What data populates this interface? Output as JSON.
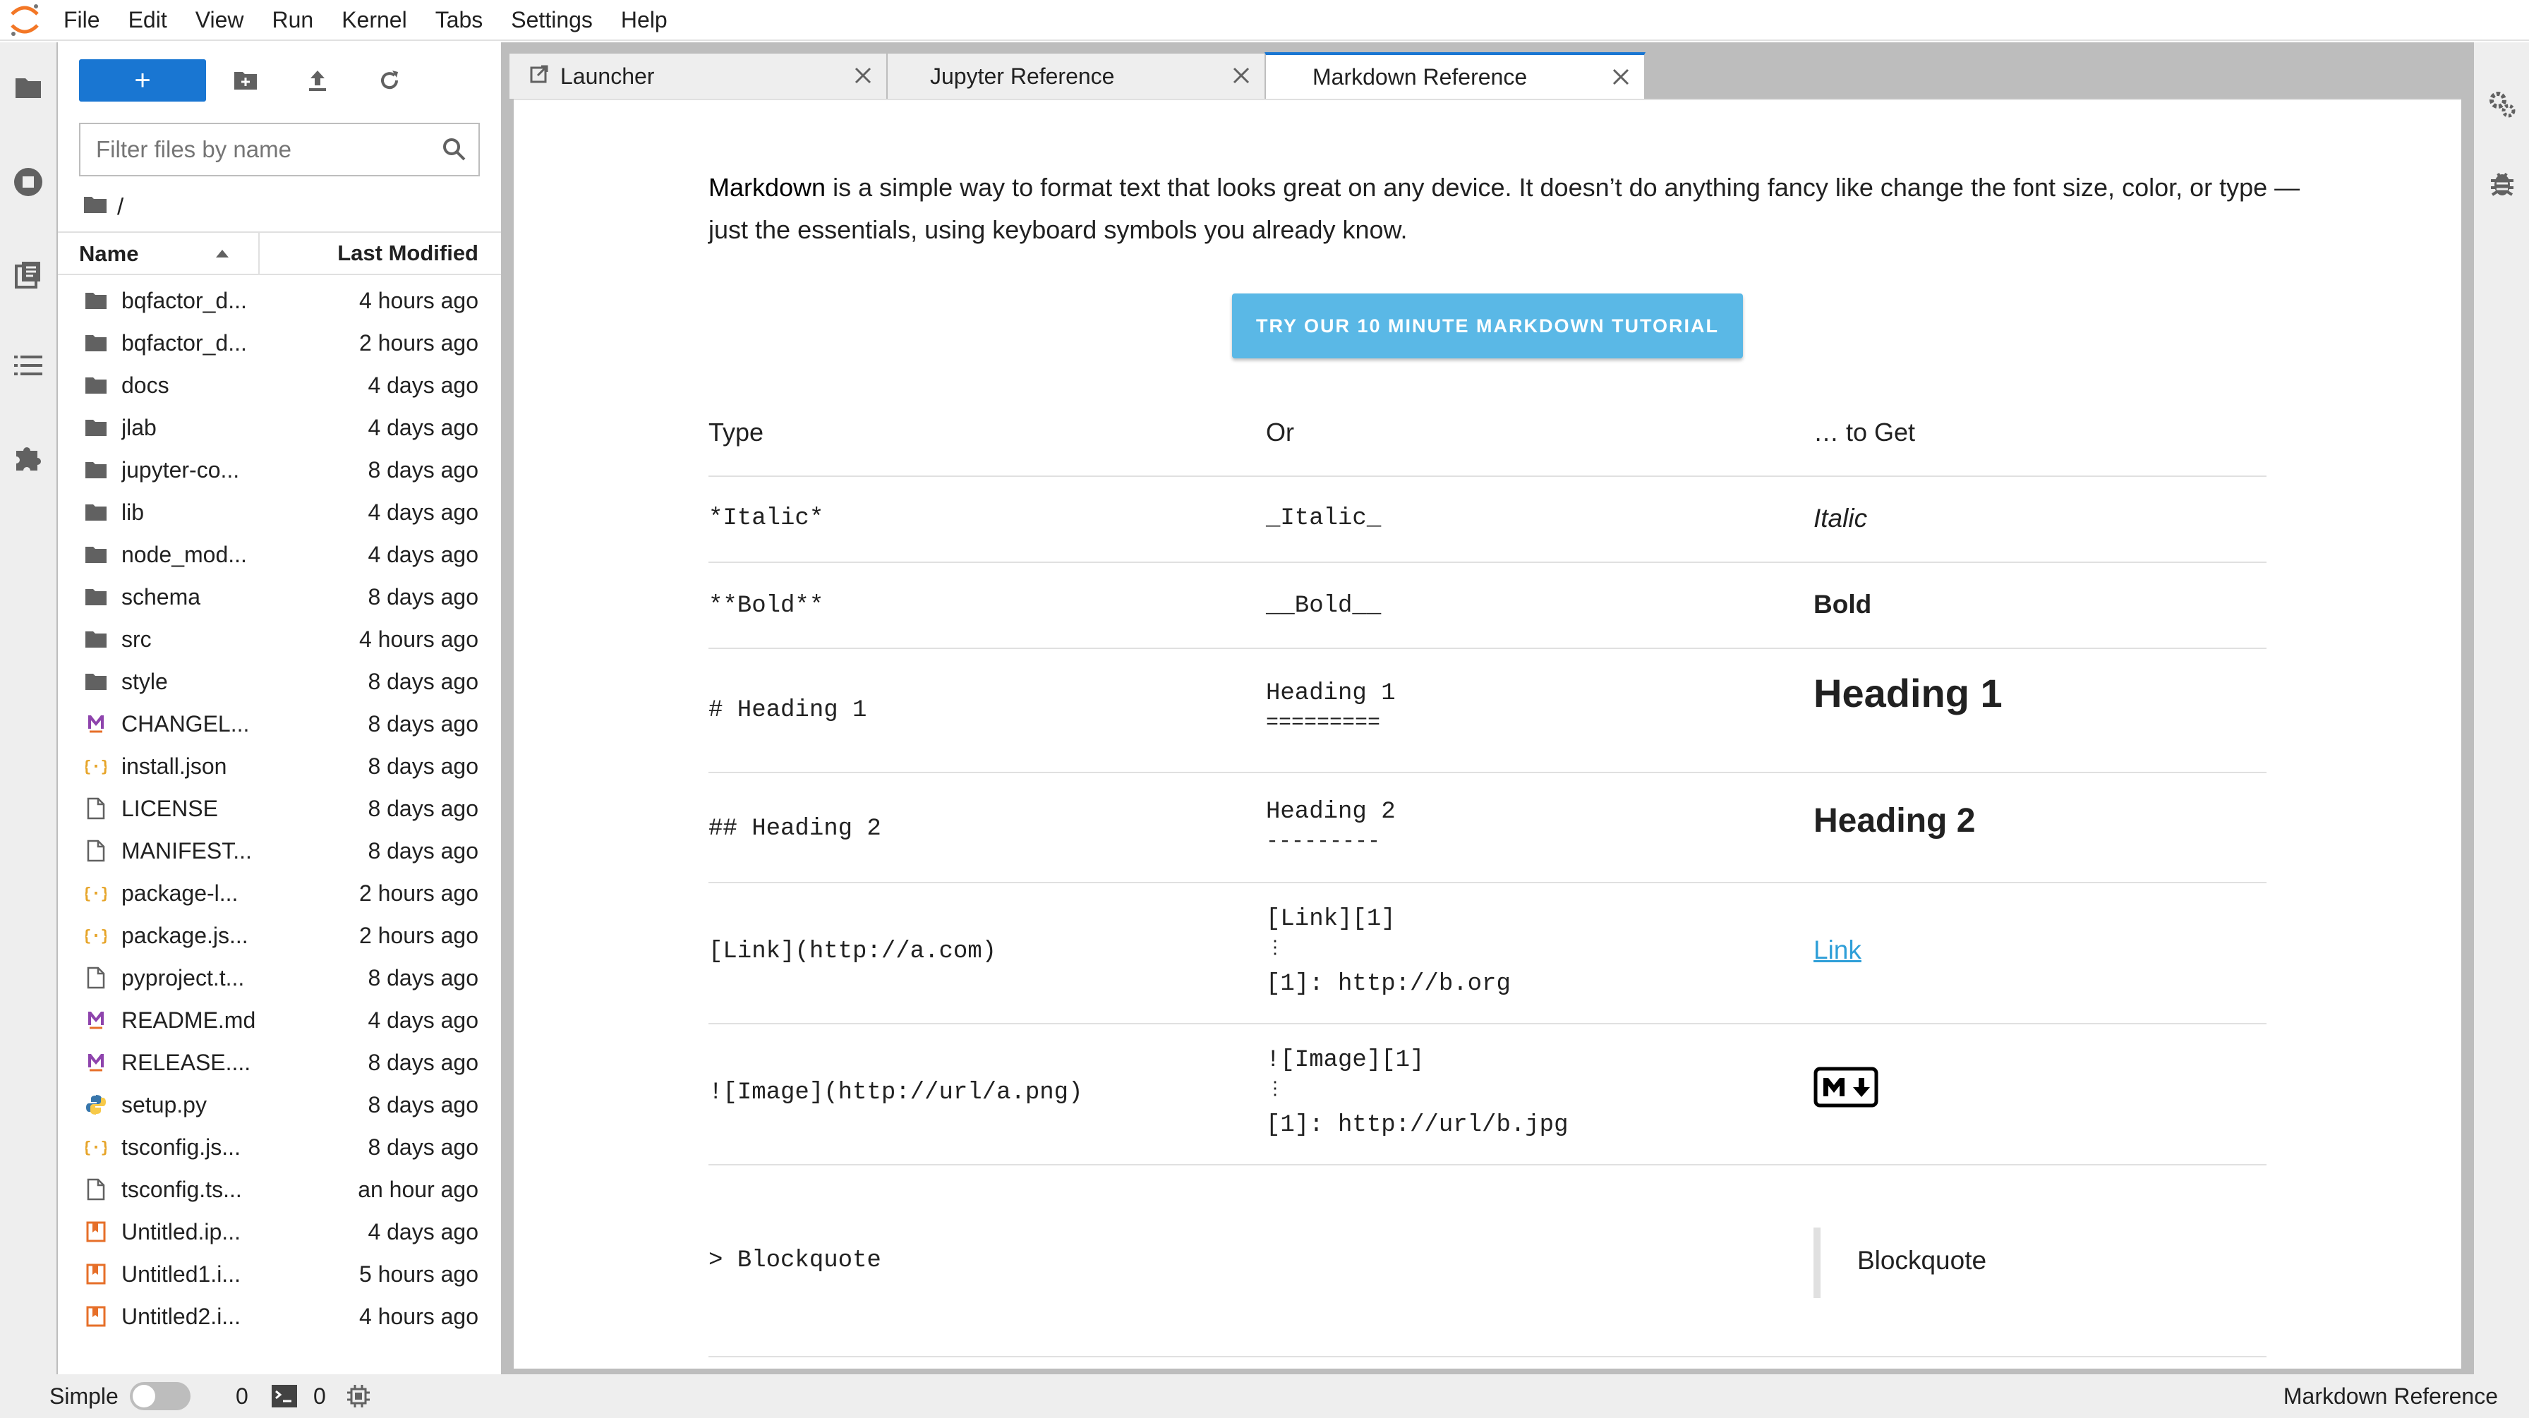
{
  "menu": [
    "File",
    "Edit",
    "View",
    "Run",
    "Kernel",
    "Tabs",
    "Settings",
    "Help"
  ],
  "filebrowser": {
    "new_label": "+",
    "filter_placeholder": "Filter files by name",
    "breadcrumb": "/",
    "header": {
      "name": "Name",
      "modified": "Last Modified"
    },
    "files": [
      {
        "name": "bqfactor_d...",
        "modified": "4 hours ago",
        "icon": "folder"
      },
      {
        "name": "bqfactor_d...",
        "modified": "2 hours ago",
        "icon": "folder"
      },
      {
        "name": "docs",
        "modified": "4 days ago",
        "icon": "folder"
      },
      {
        "name": "jlab",
        "modified": "4 days ago",
        "icon": "folder"
      },
      {
        "name": "jupyter-co...",
        "modified": "8 days ago",
        "icon": "folder"
      },
      {
        "name": "lib",
        "modified": "4 days ago",
        "icon": "folder"
      },
      {
        "name": "node_mod...",
        "modified": "4 days ago",
        "icon": "folder"
      },
      {
        "name": "schema",
        "modified": "8 days ago",
        "icon": "folder"
      },
      {
        "name": "src",
        "modified": "4 hours ago",
        "icon": "folder"
      },
      {
        "name": "style",
        "modified": "8 days ago",
        "icon": "folder"
      },
      {
        "name": "CHANGEL...",
        "modified": "8 days ago",
        "icon": "markdown"
      },
      {
        "name": "install.json",
        "modified": "8 days ago",
        "icon": "json"
      },
      {
        "name": "LICENSE",
        "modified": "8 days ago",
        "icon": "file"
      },
      {
        "name": "MANIFEST...",
        "modified": "8 days ago",
        "icon": "file"
      },
      {
        "name": "package-l...",
        "modified": "2 hours ago",
        "icon": "json"
      },
      {
        "name": "package.js...",
        "modified": "2 hours ago",
        "icon": "json"
      },
      {
        "name": "pyproject.t...",
        "modified": "8 days ago",
        "icon": "file"
      },
      {
        "name": "README.md",
        "modified": "4 days ago",
        "icon": "markdown"
      },
      {
        "name": "RELEASE....",
        "modified": "8 days ago",
        "icon": "markdown"
      },
      {
        "name": "setup.py",
        "modified": "8 days ago",
        "icon": "python"
      },
      {
        "name": "tsconfig.js...",
        "modified": "8 days ago",
        "icon": "json"
      },
      {
        "name": "tsconfig.ts...",
        "modified": "an hour ago",
        "icon": "file"
      },
      {
        "name": "Untitled.ip...",
        "modified": "4 days ago",
        "icon": "notebook"
      },
      {
        "name": "Untitled1.i...",
        "modified": "5 hours ago",
        "icon": "notebook"
      },
      {
        "name": "Untitled2.i...",
        "modified": "4 hours ago",
        "icon": "notebook"
      }
    ]
  },
  "tabs": [
    {
      "label": "Launcher",
      "active": false
    },
    {
      "label": "Jupyter Reference",
      "active": false
    },
    {
      "label": "Markdown Reference",
      "active": true
    }
  ],
  "doc": {
    "intro_bold": "Markdown",
    "intro_rest": " is a simple way to format text that looks great on any device. It doesn’t do anything fancy like change the font size, color, or type — just the essentials, using keyboard symbols you already know.",
    "tutorial_button": "TRY OUR 10 MINUTE MARKDOWN TUTORIAL",
    "table_header": {
      "type": "Type",
      "or": "Or",
      "get": "… to Get"
    },
    "rows": {
      "italic": {
        "type": "*Italic*",
        "or": "_Italic_",
        "get": "Italic"
      },
      "bold": {
        "type": "**Bold**",
        "or": "__Bold__",
        "get": "Bold"
      },
      "h1": {
        "type": "# Heading 1",
        "or1": "Heading 1",
        "or2": "=========",
        "get": "Heading 1"
      },
      "h2": {
        "type": "## Heading 2",
        "or1": "Heading 2",
        "or2": "---------",
        "get": "Heading 2"
      },
      "link": {
        "type": "[Link](http://a.com)",
        "or1": "[Link][1]",
        "or2": "⋮",
        "or3": "[1]: http://b.org",
        "get": "Link"
      },
      "image": {
        "type": "![Image](http://url/a.png)",
        "or1": "![Image][1]",
        "or2": "⋮",
        "or3": "[1]: http://url/b.jpg",
        "get_icon": "markdown-logo-icon"
      },
      "quote": {
        "type": "> Blockquote",
        "get": "Blockquote"
      }
    }
  },
  "statusbar": {
    "mode_label": "Simple",
    "kernels": "0",
    "terminals": "0",
    "current": "Markdown Reference"
  },
  "colors": {
    "accent": "#1976d2",
    "tutorial": "#5ab8e6",
    "link": "#2f9fd8",
    "orange": "#e66f29",
    "purple": "#8e44ad"
  }
}
